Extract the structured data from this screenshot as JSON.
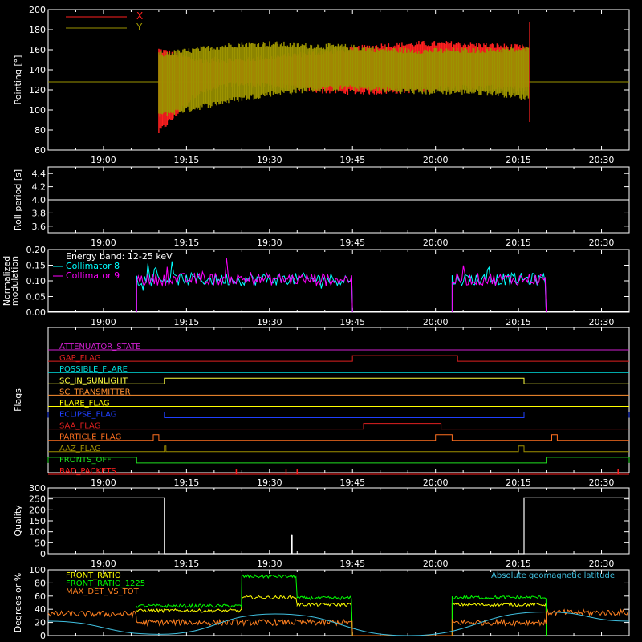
{
  "chart_data": [
    {
      "type": "line",
      "ylabel": "Pointing [°]",
      "ylim": [
        60,
        200
      ],
      "yticks": [
        60,
        80,
        100,
        120,
        140,
        160,
        180,
        200
      ],
      "xlim": [
        "18:50",
        "20:35"
      ],
      "xticks": [
        "19:00",
        "19:15",
        "19:30",
        "19:45",
        "20:00",
        "20:15",
        "20:30"
      ],
      "constant_line": {
        "y": 128,
        "color": "#9c9400"
      },
      "series": [
        {
          "name": "X",
          "color": "#ff2020",
          "start": "19:10",
          "end": "20:17",
          "upper": [
            [
              0,
              160
            ],
            [
              0.1,
              150
            ],
            [
              0.2,
              150
            ],
            [
              0.3,
              152
            ],
            [
              0.4,
              156
            ],
            [
              0.5,
              160
            ],
            [
              0.6,
              164
            ],
            [
              0.7,
              166
            ],
            [
              0.8,
              166
            ],
            [
              0.9,
              164
            ],
            [
              1,
              162
            ]
          ],
          "lower": [
            [
              0,
              78
            ],
            [
              0.1,
              115
            ],
            [
              0.2,
              126
            ],
            [
              0.3,
              124
            ],
            [
              0.4,
              120
            ],
            [
              0.5,
              118
            ],
            [
              0.6,
              118
            ],
            [
              0.7,
              120
            ],
            [
              0.8,
              122
            ],
            [
              0.9,
              122
            ],
            [
              1,
              120
            ]
          ]
        },
        {
          "name": "Y",
          "color": "#9c9400",
          "start": "19:10",
          "end": "20:17",
          "upper": [
            [
              0,
              155
            ],
            [
              0.1,
              160
            ],
            [
              0.2,
              165
            ],
            [
              0.3,
              166
            ],
            [
              0.4,
              164
            ],
            [
              0.5,
              163
            ],
            [
              0.6,
              160
            ],
            [
              0.7,
              159
            ],
            [
              0.8,
              159
            ],
            [
              0.9,
              160
            ],
            [
              1,
              160
            ]
          ],
          "lower": [
            [
              0,
              95
            ],
            [
              0.1,
              102
            ],
            [
              0.2,
              110
            ],
            [
              0.3,
              116
            ],
            [
              0.4,
              120
            ],
            [
              0.5,
              122
            ],
            [
              0.6,
              120
            ],
            [
              0.7,
              118
            ],
            [
              0.8,
              118
            ],
            [
              0.9,
              117
            ],
            [
              1,
              112
            ]
          ]
        }
      ]
    },
    {
      "type": "line",
      "ylabel": "Roll period [s]",
      "ylim": [
        3.5,
        4.5
      ],
      "yticks": [
        3.6,
        3.8,
        4.0,
        4.2,
        4.4
      ],
      "xlim": [
        "18:50",
        "20:35"
      ],
      "xticks": [
        "19:00",
        "19:15",
        "19:30",
        "19:45",
        "20:00",
        "20:15",
        "20:30"
      ],
      "series": [
        {
          "color": "#ffffff",
          "x": [
            "18:50",
            "20:35"
          ],
          "y": [
            4.0,
            4.0
          ]
        }
      ]
    },
    {
      "type": "line",
      "ylabel": "Normalized modulation",
      "ylim": [
        0,
        0.2
      ],
      "yticks": [
        0.0,
        0.05,
        0.1,
        0.15,
        0.2
      ],
      "xlim": [
        "18:50",
        "20:35"
      ],
      "xticks": [
        "19:00",
        "19:15",
        "19:30",
        "19:45",
        "20:00",
        "20:15",
        "20:30"
      ],
      "annotation": "Energy band: 12-25 keV",
      "series": [
        {
          "name": "Collimator 8",
          "color": "#00ffff",
          "intervals": [
            [
              "19:06",
              "19:45"
            ],
            [
              "20:03",
              "20:20"
            ]
          ],
          "mean": 0.105,
          "spread": 0.02
        },
        {
          "name": "Collimator 9",
          "color": "#ff00ff",
          "intervals": [
            [
              "19:06",
              "19:45"
            ],
            [
              "20:03",
              "20:20"
            ]
          ],
          "mean": 0.105,
          "spread": 0.02
        }
      ]
    },
    {
      "type": "line",
      "ylabel": "Flags",
      "xlim": [
        "18:50",
        "20:35"
      ],
      "xticks": [
        "19:00",
        "19:15",
        "19:30",
        "19:45",
        "20:00",
        "20:15",
        "20:30"
      ],
      "series": [
        {
          "name": "ATTENUATOR_STATE",
          "color": "#d020d0",
          "on": []
        },
        {
          "name": "GAP_FLAG",
          "color": "#e02020",
          "on": [
            [
              "19:45",
              "20:04"
            ]
          ]
        },
        {
          "name": "POSSIBLE_FLARE",
          "color": "#00e0e0",
          "on": []
        },
        {
          "name": "SC_IN_SUNLIGHT",
          "color": "#ffff40",
          "on": [
            [
              "19:11",
              "20:16"
            ]
          ]
        },
        {
          "name": "SC_TRANSMITTER",
          "color": "#ff9030",
          "on": []
        },
        {
          "name": "FLARE_FLAG",
          "color": "#ffff00",
          "on": []
        },
        {
          "name": "ECLIPSE_FLAG",
          "color": "#2040ff",
          "on": [
            [
              "18:50",
              "19:11"
            ],
            [
              "20:16",
              "20:35"
            ]
          ]
        },
        {
          "name": "SAA_FLAG",
          "color": "#e02020",
          "on": [
            [
              "19:47",
              "20:01"
            ]
          ]
        },
        {
          "name": "PARTICLE_FLAG",
          "color": "#ff7020",
          "on": [
            [
              "19:09",
              "19:10"
            ],
            [
              "20:00",
              "20:03"
            ],
            [
              "20:21",
              "20:22"
            ]
          ]
        },
        {
          "name": "AAZ_FLAG",
          "color": "#a09000",
          "on": [
            [
              "19:11",
              "19:11"
            ],
            [
              "20:15",
              "20:16"
            ]
          ]
        },
        {
          "name": "FRONTS_OFF",
          "color": "#20e020",
          "on": [
            [
              "18:50",
              "19:06"
            ],
            [
              "20:20",
              "20:35"
            ]
          ]
        },
        {
          "name": "BAD_PACKETS",
          "color": "#ff2020",
          "spikes": [
            "19:24",
            "19:33",
            "19:35",
            "20:33"
          ]
        }
      ]
    },
    {
      "type": "line",
      "ylabel": "Quality",
      "ylim": [
        0,
        300
      ],
      "yticks": [
        0,
        50,
        100,
        150,
        200,
        250,
        300
      ],
      "xlim": [
        "18:50",
        "20:35"
      ],
      "xticks": [
        "19:00",
        "19:15",
        "19:30",
        "19:45",
        "20:00",
        "20:15",
        "20:30"
      ],
      "series": [
        {
          "color": "#ffffff",
          "x": [
            "18:50",
            "19:11",
            "19:11",
            "19:34",
            "19:34",
            "19:34",
            "19:34",
            "20:16",
            "20:16",
            "20:35"
          ],
          "y": [
            255,
            255,
            0,
            0,
            85,
            85,
            0,
            0,
            255,
            255
          ]
        }
      ]
    },
    {
      "type": "line",
      "ylabel": "Degrees or %",
      "ylim": [
        0,
        100
      ],
      "yticks": [
        0,
        20,
        40,
        60,
        80,
        100
      ],
      "xlim": [
        "18:50",
        "20:35"
      ],
      "xticks": [
        "19:00",
        "19:15",
        "19:30",
        "19:45",
        "20:00",
        "20:15",
        "20:30"
      ],
      "series": [
        {
          "name": "FRONT_RATIO",
          "color": "#ffff00",
          "x": [
            "19:06",
            "19:06",
            "19:25",
            "19:25",
            "19:35",
            "19:35",
            "19:45",
            "19:45",
            "20:03",
            "20:03",
            "20:20",
            "20:20"
          ],
          "y": [
            0,
            38,
            38,
            58,
            58,
            47,
            47,
            0,
            0,
            47,
            47,
            0
          ]
        },
        {
          "name": "FRONT_RATIO_1225",
          "color": "#00ff00",
          "x": [
            "19:06",
            "19:06",
            "19:25",
            "19:25",
            "19:35",
            "19:35",
            "19:45",
            "19:45",
            "20:03",
            "20:03",
            "20:20",
            "20:20"
          ],
          "y": [
            0,
            45,
            45,
            90,
            90,
            57,
            57,
            0,
            0,
            58,
            58,
            0
          ]
        },
        {
          "name": "MAX_DET_VS_TOT",
          "color": "#ff8020",
          "x": [
            "18:50",
            "19:06",
            "19:06",
            "19:45",
            "19:45",
            "20:03",
            "20:03",
            "20:20",
            "20:20",
            "20:35"
          ],
          "y": [
            33,
            33,
            20,
            20,
            0,
            0,
            20,
            20,
            35,
            35
          ]
        },
        {
          "name": "Absolute geomagnetic latitude",
          "color": "#40c0e0",
          "x": [
            "18:50",
            "19:10",
            "19:31",
            "19:55",
            "20:20",
            "20:35"
          ],
          "y": [
            22,
            2,
            33,
            0,
            36,
            22
          ]
        }
      ]
    }
  ]
}
